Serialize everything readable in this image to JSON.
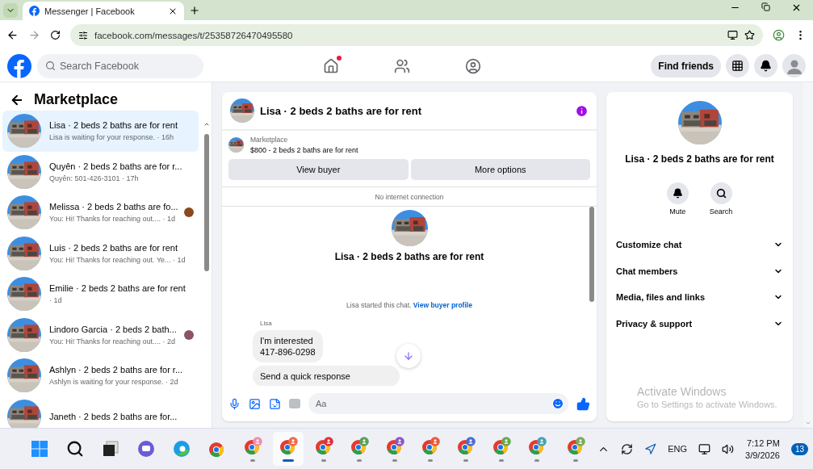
{
  "browser": {
    "tab_title": "Messenger | Facebook",
    "url": "facebook.com/messages/t/25358726470495580"
  },
  "topbar": {
    "search_placeholder": "Search Facebook",
    "find_friends": "Find friends",
    "home_badge": true
  },
  "sidebar": {
    "title": "Marketplace",
    "items": [
      {
        "title": "Lisa · 2 beds 2 baths are for rent",
        "subtitle": "Lisa is waiting for your response. · 16h",
        "selected": true
      },
      {
        "title": "Quyên · 2 beds 2 baths are for r...",
        "subtitle": "Quyên: 501-426-3101 · 17h",
        "selected": false
      },
      {
        "title": "Melissa · 2 beds 2 baths are fo...",
        "subtitle": "You: Hi! Thanks for reaching out.... · 1d",
        "selected": false,
        "color": "#8a4a1c"
      },
      {
        "title": "Luis · 2 beds 2 baths are for rent",
        "subtitle": "You: Hi! Thanks for reaching out. Ye... · 1d",
        "selected": false
      },
      {
        "title": "Emilie · 2 beds 2 baths are for rent",
        "subtitle": "· 1d",
        "selected": false
      },
      {
        "title": "Lindoro Garcia · 2 beds 2 bath...",
        "subtitle": "You: Hi! Thanks for reaching out.... · 2d",
        "selected": false,
        "color": "#8a5560"
      },
      {
        "title": "Ashlyn · 2 beds 2 baths are for r...",
        "subtitle": "Ashlyn is waiting for your response. · 2d",
        "selected": false
      },
      {
        "title": "Janeth · 2 beds 2 baths are for...",
        "selected": false
      }
    ]
  },
  "chat": {
    "title": "Lisa · 2 beds 2 baths are for rent",
    "listing_label": "Marketplace",
    "listing_title": "$800 - 2 beds 2 baths are for rent",
    "buttons": [
      "View buyer",
      "More options"
    ],
    "notice": "No internet connection",
    "profile_name": "Lisa · 2 beds 2 baths are for rent",
    "started": "Lisa started this chat.",
    "started_link": "View buyer profile",
    "sender": "Lisa",
    "messages": [
      {
        "lines": [
          "I'm interested",
          "417-896-0298"
        ]
      },
      {
        "lines": [
          "Send a quick response"
        ]
      }
    ],
    "composer_placeholder": "Aa"
  },
  "details": {
    "name": "Lisa · 2 beds 2 baths are for rent",
    "actions": [
      {
        "kind": "mute",
        "label": "Mute"
      },
      {
        "kind": "search",
        "label": "Search"
      }
    ],
    "sections": [
      {
        "label": "Customize chat",
        "expanded": false
      },
      {
        "label": "Chat members",
        "expanded": false
      },
      {
        "label": "Media, files and links",
        "expanded": false
      },
      {
        "label": "Privacy & support",
        "expanded": false
      }
    ]
  },
  "activation": {
    "title": "Activate Windows",
    "subtitle": "Go to Settings to activate Windows."
  },
  "taskbar": {
    "apps": [
      {
        "kind": "windows"
      },
      {
        "kind": "search"
      },
      {
        "kind": "taskview"
      },
      {
        "kind": "teams"
      },
      {
        "kind": "edge"
      },
      {
        "kind": "chrome"
      },
      {
        "kind": "chrome-profile",
        "color": "#f28bb0",
        "selected": false
      },
      {
        "kind": "chrome-profile",
        "color": "#f26b4a",
        "selected": true
      },
      {
        "kind": "chrome-profile",
        "color": "#e0303c",
        "selected": false
      },
      {
        "kind": "chrome-profile",
        "color": "#5aa05a",
        "selected": false
      },
      {
        "kind": "chrome-profile",
        "color": "#8a56c8",
        "selected": false
      },
      {
        "kind": "chrome-profile",
        "color": "#e85a3a",
        "selected": false
      },
      {
        "kind": "chrome-profile",
        "color": "#4a6ed0",
        "selected": false
      },
      {
        "kind": "chrome-profile",
        "color": "#6aa84f",
        "selected": false
      },
      {
        "kind": "chrome-profile",
        "color": "#4aa0b0",
        "selected": false
      },
      {
        "kind": "chrome-profile",
        "color": "#7aaa5a",
        "selected": false
      }
    ],
    "language": "ENG",
    "time": "7:12 PM",
    "date": "3/9/2026",
    "notifications": "13"
  }
}
